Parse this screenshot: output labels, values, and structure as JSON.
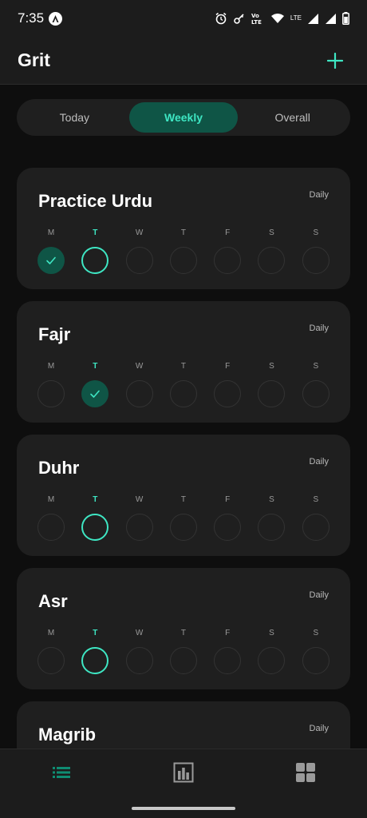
{
  "status_bar": {
    "time": "7:35",
    "lte_label": "LTE",
    "volte_label": "Vo))\nLTE"
  },
  "app_bar": {
    "title": "Grit",
    "add_icon": "plus-icon"
  },
  "tabs": [
    {
      "label": "Today",
      "active": false
    },
    {
      "label": "Weekly",
      "active": true
    },
    {
      "label": "Overall",
      "active": false
    }
  ],
  "day_letters": [
    "M",
    "T",
    "W",
    "T",
    "F",
    "S",
    "S"
  ],
  "today_index": 1,
  "habits": [
    {
      "name": "Practice Urdu",
      "frequency": "Daily",
      "completed": [
        true,
        false,
        false,
        false,
        false,
        false,
        false
      ]
    },
    {
      "name": "Fajr",
      "frequency": "Daily",
      "completed": [
        false,
        true,
        false,
        false,
        false,
        false,
        false
      ]
    },
    {
      "name": "Duhr",
      "frequency": "Daily",
      "completed": [
        false,
        false,
        false,
        false,
        false,
        false,
        false
      ]
    },
    {
      "name": "Asr",
      "frequency": "Daily",
      "completed": [
        false,
        false,
        false,
        false,
        false,
        false,
        false
      ]
    },
    {
      "name": "Magrib",
      "frequency": "Daily",
      "completed": [
        false,
        false,
        false,
        false,
        false,
        false,
        false
      ]
    }
  ],
  "bottom_nav": [
    {
      "icon": "list-icon",
      "active": true
    },
    {
      "icon": "bar-chart-icon",
      "active": false
    },
    {
      "icon": "grid-icon",
      "active": false
    }
  ],
  "colors": {
    "accent": "#3ee6c3",
    "accent_dark": "#0f5546",
    "card": "#1f1f1f",
    "background": "#0e0e0e"
  }
}
